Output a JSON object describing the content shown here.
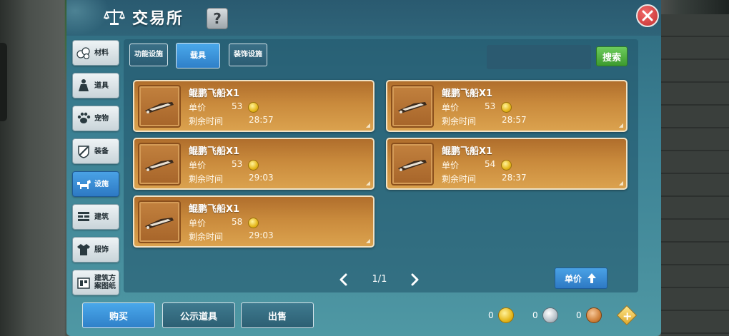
{
  "header": {
    "title": "交易所",
    "help_label": "?"
  },
  "sidebar": {
    "items": [
      {
        "label": "材料",
        "icon": "materials-icon",
        "active": false
      },
      {
        "label": "道具",
        "icon": "items-icon",
        "active": false
      },
      {
        "label": "宠物",
        "icon": "pet-paw-icon",
        "active": false
      },
      {
        "label": "装备",
        "icon": "equipment-icon",
        "active": false
      },
      {
        "label": "设施",
        "icon": "facility-horse-icon",
        "active": true
      },
      {
        "label": "建筑",
        "icon": "building-icon",
        "active": false
      },
      {
        "label": "服饰",
        "icon": "clothing-icon",
        "active": false
      },
      {
        "label": "建筑方案图纸",
        "icon": "blueprint-icon",
        "active": false
      }
    ]
  },
  "subtabs": [
    {
      "label": "功能设施",
      "active": false
    },
    {
      "label": "载具",
      "active": true
    },
    {
      "label": "装饰设施",
      "active": false
    }
  ],
  "search": {
    "placeholder": "",
    "button_label": "搜索"
  },
  "listings": [
    {
      "name": "鲲鹏飞船X1",
      "price_label": "单价",
      "price": "53",
      "time_label": "剩余时间",
      "time": "28:57"
    },
    {
      "name": "鲲鹏飞船X1",
      "price_label": "单价",
      "price": "53",
      "time_label": "剩余时间",
      "time": "28:57"
    },
    {
      "name": "鲲鹏飞船X1",
      "price_label": "单价",
      "price": "53",
      "time_label": "剩余时间",
      "time": "29:03"
    },
    {
      "name": "鲲鹏飞船X1",
      "price_label": "单价",
      "price": "54",
      "time_label": "剩余时间",
      "time": "28:37"
    },
    {
      "name": "鲲鹏飞船X1",
      "price_label": "单价",
      "price": "58",
      "time_label": "剩余时间",
      "time": "29:03"
    }
  ],
  "pagination": {
    "text": "1/1"
  },
  "sort": {
    "label": "单价"
  },
  "bottom_tabs": [
    {
      "label": "购买",
      "active": true
    },
    {
      "label": "公示道具",
      "active": false
    },
    {
      "label": "出售",
      "active": false
    }
  ],
  "currencies": {
    "gold": "0",
    "silver": "0",
    "copper": "0"
  },
  "colors": {
    "panel": "#3b8093",
    "card": "#c98a3c",
    "active_tab": "#2f80c9",
    "search_button": "#3c9a2e",
    "close": "#c22e2e"
  }
}
